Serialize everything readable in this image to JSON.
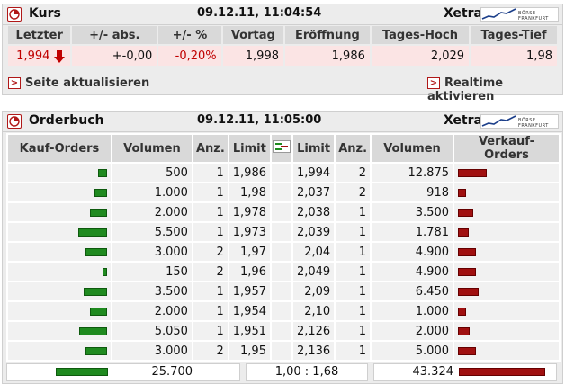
{
  "kurs": {
    "title": "Kurs",
    "timestamp": "09.12.11, 11:04:54",
    "exchange": "Xetra",
    "logo_text": "BÖRSE FRANKFURT",
    "headers": [
      "Letzter",
      "+/- abs.",
      "+/- %",
      "Vortag",
      "Eröffnung",
      "Tages-Hoch",
      "Tages-Tief"
    ],
    "values": {
      "letzter": "1,994",
      "abs": "+-0,00",
      "pct": "-0,20%",
      "vortag": "1,998",
      "eroeffnung": "1,986",
      "hoch": "2,029",
      "tief": "1,98"
    },
    "refresh_label": "Seite aktualisieren",
    "realtime_label": "Realtime aktivieren",
    "link_marker": ">"
  },
  "orderbuch": {
    "title": "Orderbuch",
    "timestamp": "09.12.11, 11:05:00",
    "exchange": "Xetra",
    "logo_text": "BÖRSE FRANKFURT",
    "headers": {
      "kauf": "Kauf-Orders",
      "volumen_bid": "Volumen",
      "anz_bid": "Anz.",
      "limit_bid": "Limit",
      "limit_ask": "Limit",
      "anz_ask": "Anz.",
      "volumen_ask": "Volumen",
      "verkauf": "Verkauf-Orders"
    },
    "rows": [
      {
        "bid_vol": "500",
        "bid_anz": "1",
        "bid_limit": "1,986",
        "ask_limit": "1,994",
        "ask_anz": "2",
        "ask_vol": "12.875"
      },
      {
        "bid_vol": "1.000",
        "bid_anz": "1",
        "bid_limit": "1,98",
        "ask_limit": "2,037",
        "ask_anz": "2",
        "ask_vol": "918"
      },
      {
        "bid_vol": "2.000",
        "bid_anz": "1",
        "bid_limit": "1,978",
        "ask_limit": "2,038",
        "ask_anz": "1",
        "ask_vol": "3.500"
      },
      {
        "bid_vol": "5.500",
        "bid_anz": "1",
        "bid_limit": "1,973",
        "ask_limit": "2,039",
        "ask_anz": "1",
        "ask_vol": "1.781"
      },
      {
        "bid_vol": "3.000",
        "bid_anz": "2",
        "bid_limit": "1,97",
        "ask_limit": "2,04",
        "ask_anz": "1",
        "ask_vol": "4.900"
      },
      {
        "bid_vol": "150",
        "bid_anz": "2",
        "bid_limit": "1,96",
        "ask_limit": "2,049",
        "ask_anz": "1",
        "ask_vol": "4.900"
      },
      {
        "bid_vol": "3.500",
        "bid_anz": "1",
        "bid_limit": "1,957",
        "ask_limit": "2,09",
        "ask_anz": "1",
        "ask_vol": "6.450"
      },
      {
        "bid_vol": "2.000",
        "bid_anz": "1",
        "bid_limit": "1,954",
        "ask_limit": "2,10",
        "ask_anz": "1",
        "ask_vol": "1.000"
      },
      {
        "bid_vol": "5.050",
        "bid_anz": "1",
        "bid_limit": "1,951",
        "ask_limit": "2,126",
        "ask_anz": "1",
        "ask_vol": "2.000"
      },
      {
        "bid_vol": "3.000",
        "bid_anz": "2",
        "bid_limit": "1,95",
        "ask_limit": "2,136",
        "ask_anz": "1",
        "ask_vol": "5.000"
      }
    ],
    "total_bid": "25.700",
    "ratio": "1,00 : 1,68",
    "total_ask": "43.324"
  },
  "colors": {
    "buy": "#1f8a1f",
    "sell": "#a01010",
    "negative": "#c00000",
    "accent": "#b01818"
  }
}
